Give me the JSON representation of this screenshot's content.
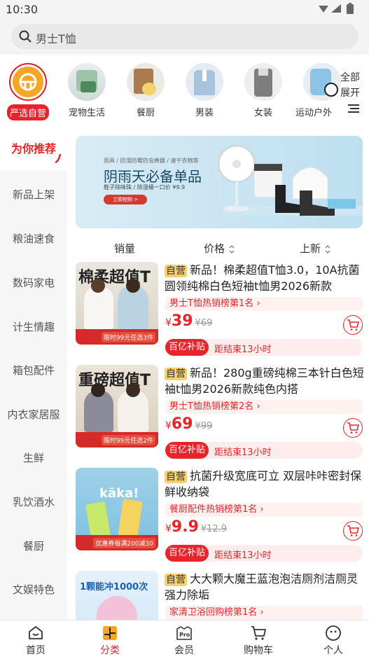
{
  "status": {
    "time": "10:30"
  },
  "search": {
    "placeholder": "男士T恤"
  },
  "categories": [
    {
      "label": "严选自营"
    },
    {
      "label": "宠物生活"
    },
    {
      "label": "餐厨"
    },
    {
      "label": "男装"
    },
    {
      "label": "女装"
    },
    {
      "label": "运动户外"
    }
  ],
  "category_more": {
    "line1": "全部",
    "line2": "展开"
  },
  "sidebar": [
    {
      "label": "为你推荐"
    },
    {
      "label": "新品上架"
    },
    {
      "label": "粮油速食"
    },
    {
      "label": "数码家电"
    },
    {
      "label": "计生情趣"
    },
    {
      "label": "箱包配件"
    },
    {
      "label": "内衣家居服"
    },
    {
      "label": "生鲜"
    },
    {
      "label": "乳饮酒水"
    },
    {
      "label": "餐厨"
    },
    {
      "label": "文娱特色"
    }
  ],
  "banner": {
    "small": "雨具 / 防滑防霉防虫棒器 / 速干衣物等",
    "title": "阴雨天必备单品",
    "sub": "鞋子除味珠 / 除湿桶一口价 ¥9.9",
    "button": "立即抢购 >"
  },
  "sort": {
    "sales": "销量",
    "price": "价格",
    "newest": "上新"
  },
  "products": [
    {
      "tag": "自营",
      "title": "新品！棉柔超值T恤3.0，10A抗菌圆领纯棉白色短袖t恤男2026新款",
      "rank": "男士T恤热销榜第1名",
      "currency": "¥",
      "price": "39",
      "old_price": "¥69",
      "sub_tag": "百亿补贴",
      "sub_text": "距结束13小时",
      "img_text": "棉柔超值T",
      "img_band": "限时99元任选3件"
    },
    {
      "tag": "自营",
      "title": "新品！280g重磅纯棉三本针白色短袖t恤男2026新款纯色内搭",
      "rank": "男士T恤热销榜第2名",
      "currency": "¥",
      "price": "69",
      "old_price": "¥99",
      "sub_tag": "百亿补贴",
      "sub_text": "距结束13小时",
      "img_text": "重磅超值T",
      "img_band": "限时99元任选2件"
    },
    {
      "tag": "自营",
      "title": "抗菌升级宽底可立 双层咔咔密封保鲜收纳袋",
      "rank": "餐厨配件热销榜第1名",
      "currency": "¥",
      "price": "9.9",
      "old_price": "¥12.9",
      "sub_tag": "百亿补贴",
      "sub_text": "距结束13小时",
      "img_text": "kāka!",
      "img_band": "优惠券每满200减30"
    },
    {
      "tag": "自营",
      "title": "大大颗大魔王蓝泡泡洁厕剂洁厕灵强力除垢",
      "rank": "家清卫浴回购榜第1名",
      "img_text": "1颗能冲1000次"
    }
  ],
  "tabs": [
    {
      "label": "首页"
    },
    {
      "label": "分类"
    },
    {
      "label": "会员"
    },
    {
      "label": "购物车"
    },
    {
      "label": "个人"
    }
  ],
  "colors": {
    "accent": "#e8232a",
    "self_tag": "#f7cf6b",
    "selected_ring": "#e02020"
  }
}
